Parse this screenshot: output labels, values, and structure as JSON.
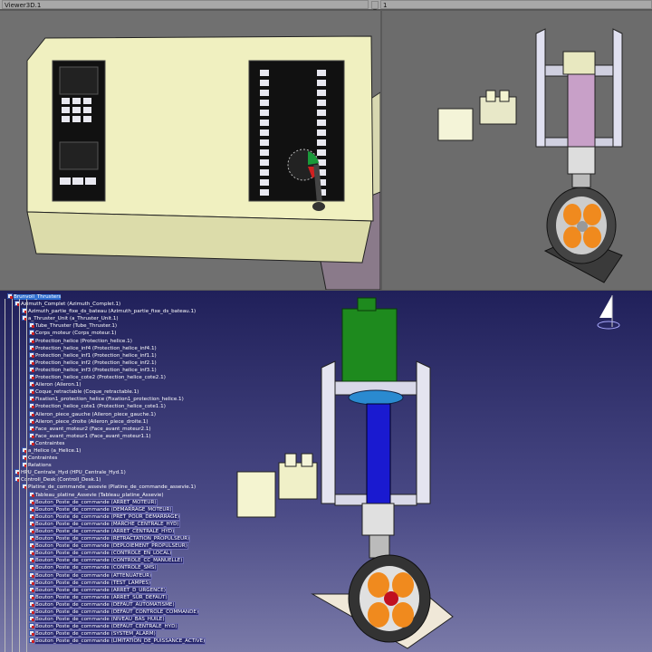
{
  "window": {
    "title": "Viewer3D.1",
    "minimize": "_",
    "page": "1"
  },
  "tree": [
    {
      "d": 0,
      "t": "Brunvoll_Thrusters",
      "s": "sel"
    },
    {
      "d": 1,
      "t": "Azimuth_Complet (Azimuth_Complet.1)"
    },
    {
      "d": 2,
      "t": "Azimuth_partie_fixe_ds_bateau (Azimuth_partie_fixe_ds_bateau.1)"
    },
    {
      "d": 2,
      "t": "a_Thruster_Unit (a_Thruster_Unit.1)"
    },
    {
      "d": 3,
      "t": "Tube_Thruster (Tube_Thruster.1)"
    },
    {
      "d": 3,
      "t": "Corps_moteur (Corps_moteur.1)"
    },
    {
      "d": 3,
      "t": "Protection_helice (Protection_helice.1)"
    },
    {
      "d": 3,
      "t": "Protection_helice_inf4 (Protection_helice_inf4.1)"
    },
    {
      "d": 3,
      "t": "Protection_helice_inf1 (Protection_helice_inf1.1)"
    },
    {
      "d": 3,
      "t": "Protection_helice_inf2 (Protection_helice_inf2.1)"
    },
    {
      "d": 3,
      "t": "Protection_helice_inf3 (Protection_helice_inf3.1)"
    },
    {
      "d": 3,
      "t": "Protection_helice_cote2 (Protection_helice_cote2.1)"
    },
    {
      "d": 3,
      "t": "Aileron (Aileron.1)"
    },
    {
      "d": 3,
      "t": "Coque_retractable (Coque_retractable.1)"
    },
    {
      "d": 3,
      "t": "Fixation1_protection_helice (Fixation1_protection_helice.1)"
    },
    {
      "d": 3,
      "t": "Protection_helice_cote1 (Protection_helice_cote1.1)"
    },
    {
      "d": 3,
      "t": "Aileron_piece_gauche (Aileron_piece_gauche.1)"
    },
    {
      "d": 3,
      "t": "Aileron_piece_droite (Aileron_piece_droite.1)"
    },
    {
      "d": 3,
      "t": "Face_avant_moteur2 (Face_avant_moteur2.1)"
    },
    {
      "d": 3,
      "t": "Face_avant_moteur1 (Face_avant_moteur1.1)"
    },
    {
      "d": 3,
      "t": "Contraintes"
    },
    {
      "d": 2,
      "t": "a_Helice (a_Helice.1)"
    },
    {
      "d": 2,
      "t": "Contraintes"
    },
    {
      "d": 2,
      "t": "Relations"
    },
    {
      "d": 1,
      "t": "HPU_Centrale_Hyd (HPU_Centrale_Hyd.1)"
    },
    {
      "d": 1,
      "t": "Controll_Desk (Controll_Desk.1)"
    },
    {
      "d": 2,
      "t": "Platine_de_commande_assevie (Platine_de_commande_assevie.1)"
    },
    {
      "d": 3,
      "t": "Tableau_platine_Assevie (Tableau_platine_Assevie)"
    },
    {
      "d": 3,
      "t": "Bouton_Poste_de_commande (ARRET_MOTEUR)",
      "s": "hl"
    },
    {
      "d": 3,
      "t": "Bouton_Poste_de_commande (DEMARRAGE_MOTEUR)",
      "s": "hl"
    },
    {
      "d": 3,
      "t": "Bouton_Poste_de_commande (PRET_POUR_DEMARRAGE)",
      "s": "hl"
    },
    {
      "d": 3,
      "t": "Bouton_Poste_de_commande (MARCHE_CENTRALE_HYD)",
      "s": "hl"
    },
    {
      "d": 3,
      "t": "Bouton_Poste_de_commande (ARRET_CENTRALE_HYD)",
      "s": "hl"
    },
    {
      "d": 3,
      "t": "Bouton_Poste_de_commande (RETRACTATION_PROPULSEUR)",
      "s": "hl"
    },
    {
      "d": 3,
      "t": "Bouton_Poste_de_commande (DEPLOIEMENT_PROPULSEUR)",
      "s": "hl"
    },
    {
      "d": 3,
      "t": "Bouton_Poste_de_commande (CONTROLE_EN_LOCAL)",
      "s": "hl"
    },
    {
      "d": 3,
      "t": "Bouton_Poste_de_commande (CONTROLE_CC_MANUELLE)",
      "s": "hl"
    },
    {
      "d": 3,
      "t": "Bouton_Poste_de_commande (CONTROLE_SMS)",
      "s": "hl"
    },
    {
      "d": 3,
      "t": "Bouton_Poste_de_commande (ATTENUATEUR)",
      "s": "hl"
    },
    {
      "d": 3,
      "t": "Bouton_Poste_de_commande (TEST_LAMPES)",
      "s": "hl"
    },
    {
      "d": 3,
      "t": "Bouton_Poste_de_commande (ARRET_D_URGENCE)",
      "s": "hl"
    },
    {
      "d": 3,
      "t": "Bouton_Poste_de_commande (ARRET_SUR_DEFAUT)",
      "s": "hl"
    },
    {
      "d": 3,
      "t": "Bouton_Poste_de_commande (DEFAUT_AUTOMATISME)",
      "s": "hl"
    },
    {
      "d": 3,
      "t": "Bouton_Poste_de_commande (DEFAUT_CONTROLE_COMMANDE)",
      "s": "hl"
    },
    {
      "d": 3,
      "t": "Bouton_Poste_de_commande (NIVEAU_BAS_HUILE)",
      "s": "hl"
    },
    {
      "d": 3,
      "t": "Bouton_Poste_de_commande (DEFAUT_CENTRALE_HYD)",
      "s": "hl"
    },
    {
      "d": 3,
      "t": "Bouton_Poste_de_commande (SYSTEM_ALARM)",
      "s": "hl"
    },
    {
      "d": 3,
      "t": "Bouton_Poste_de_commande (LIMITATION_DE_PUISSANCE_ACTIVE)",
      "s": "hl"
    }
  ],
  "colors": {
    "console": "#f0f0c0",
    "motor": "#1e8a1e",
    "tube": "#1a1ad0",
    "propeller": "#f08a1e",
    "selection": "#2f6fd0"
  }
}
